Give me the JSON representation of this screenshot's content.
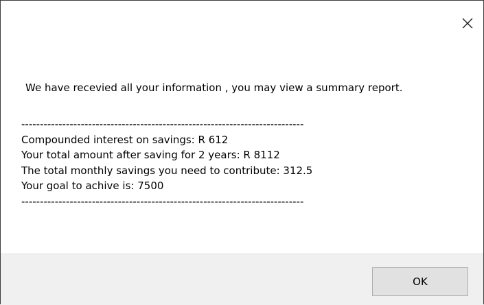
{
  "dialog": {
    "close_icon": "close-icon",
    "message": "We have recevied all your information , you may view a summary report.",
    "report_lines": [
      "----------------------------------------------------------------------------",
      "Compounded interest on savings: R 612",
      "Your total amount after saving for 2 years: R 8112",
      "The total monthly savings you need to contribute: 312.5",
      "Your goal to achive is: 7500",
      "----------------------------------------------------------------------------"
    ],
    "ok_label": "OK"
  }
}
